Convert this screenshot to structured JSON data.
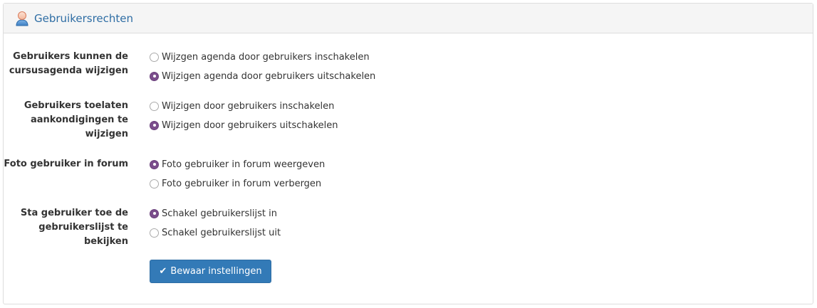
{
  "panel": {
    "title": "Gebruikersrechten",
    "icon": "user-icon"
  },
  "settings": [
    {
      "label": "Gebruikers kunnen de cursusagenda wijzigen",
      "options": [
        {
          "label": "Wijzgen agenda door gebruikers inschakelen",
          "checked": false
        },
        {
          "label": "Wijzigen agenda door gebruikers uitschakelen",
          "checked": true
        }
      ]
    },
    {
      "label": "Gebruikers toelaten aankondigingen te wijzigen",
      "options": [
        {
          "label": "Wijzigen door gebruikers inschakelen",
          "checked": false
        },
        {
          "label": "Wijzigen door gebruikers uitschakelen",
          "checked": true
        }
      ]
    },
    {
      "label": "Foto gebruiker in forum",
      "options": [
        {
          "label": "Foto gebruiker in forum weergeven",
          "checked": true
        },
        {
          "label": "Foto gebruiker in forum verbergen",
          "checked": false
        }
      ]
    },
    {
      "label": "Sta gebruiker toe de gebruikerslijst te bekijken",
      "options": [
        {
          "label": "Schakel gebruikerslijst in",
          "checked": true
        },
        {
          "label": "Schakel gebruikerslijst uit",
          "checked": false
        }
      ]
    }
  ],
  "save_button": {
    "label": "Bewaar instellingen",
    "icon": "check-icon"
  },
  "colors": {
    "accent": "#337ab7",
    "radio_checked": "#7b4e8c",
    "title": "#2e6da4"
  }
}
